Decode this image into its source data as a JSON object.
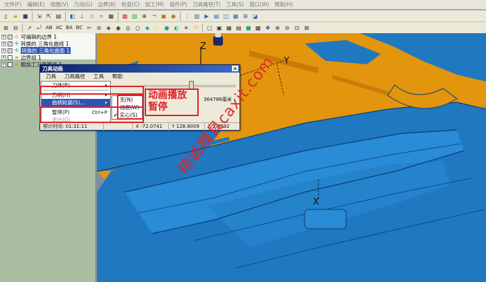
{
  "menubar": {
    "items": [
      "文件(F)",
      "编辑(E)",
      "视图(V)",
      "几何(G)",
      "边界(B)",
      "检查(C)",
      "加工(M)",
      "插件(P)",
      "刀具路径(T)",
      "工具(S)",
      "窗口(W)",
      "帮助(H)"
    ]
  },
  "toolbar2_texts": {
    "ab": "AB",
    "ac": "AC",
    "ba": "BA",
    "bc": "BC"
  },
  "tree": {
    "items": [
      {
        "label": "可编辑的边界 1",
        "checked": true,
        "selected": false
      },
      {
        "label": "转换的 三角化曲线 1",
        "checked": true,
        "selected": false
      },
      {
        "label": "转换的 三角化曲面 1",
        "checked": true,
        "selected": true
      },
      {
        "label": "边界组 1",
        "checked": false,
        "selected": false
      },
      {
        "label": "粗加工刀具路径 1",
        "checked": false,
        "selected": false
      }
    ]
  },
  "axes": {
    "z": "Z",
    "y": "Y",
    "x": "X"
  },
  "dialog": {
    "title": "刀具动画",
    "close": "✕",
    "menu": [
      "刀具",
      "刀具路径",
      "工具",
      "帮助"
    ],
    "dropdown": [
      {
        "label": "刀体(B)",
        "arrow": "▸",
        "highlighted": false
      },
      {
        "label": "刀柄(H)",
        "arrow": "▸",
        "highlighted": false
      },
      {
        "label": "曲柄轮廓(S)...",
        "arrow": "▸",
        "highlighted": true
      },
      {
        "label": "暂停(P)",
        "accel": "Ctrl+P",
        "highlighted": false
      },
      {
        "label": "退出(Q)",
        "highlighted": false
      }
    ],
    "submenu": [
      {
        "label": "无(N)",
        "checked": false
      },
      {
        "label": "线框(W)",
        "checked": false
      },
      {
        "label": "实心(S)",
        "checked": true
      }
    ],
    "progress": 0.52,
    "length_text": "364786毫米",
    "status": {
      "time": "预计时间: 01:31:11",
      "x": "X  -72.0741",
      "y": "Y  128.8009",
      "z": "Z  1.8392"
    }
  },
  "annotation": {
    "line1": "动画播放",
    "line2": "暂停"
  },
  "watermark": "精诚模具caxit.com",
  "colors": {
    "orange": "#e3950d",
    "blue": "#1f78c0",
    "red": "#e0232a"
  }
}
